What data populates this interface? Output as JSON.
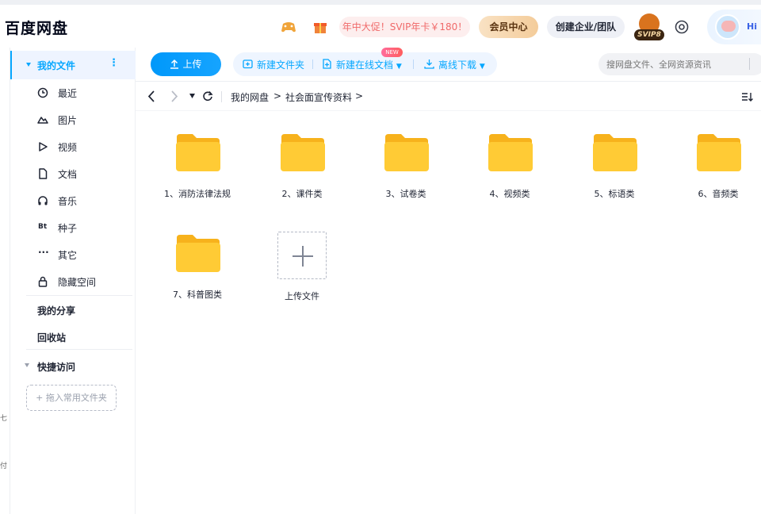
{
  "header": {
    "logo": "百度网盘",
    "promo": "年中大促！SVIP年卡￥180！",
    "vip_center": "会员中心",
    "create_team": "创建企业/团队",
    "svip_badge": "SVIP8",
    "greeting": "Hi"
  },
  "left_edge": {
    "glyphs": [
      "七",
      "付"
    ]
  },
  "sidebar": {
    "my_files": "我的文件",
    "more": "⋮",
    "items": [
      {
        "label": "最近",
        "icon": "clock-icon"
      },
      {
        "label": "图片",
        "icon": "image-icon"
      },
      {
        "label": "视频",
        "icon": "play-icon"
      },
      {
        "label": "文档",
        "icon": "document-icon"
      },
      {
        "label": "音乐",
        "icon": "headphones-icon"
      },
      {
        "label": "种子",
        "icon_text": "Bt"
      },
      {
        "label": "其它",
        "icon_text": "···"
      },
      {
        "label": "隐藏空间",
        "icon": "lock-icon"
      }
    ],
    "my_share": "我的分享",
    "recycle_bin": "回收站",
    "quick_access": "快捷访问",
    "dropzone": "+ 拖入常用文件夹"
  },
  "toolbar": {
    "upload": "上传",
    "new_folder": "新建文件夹",
    "new_online_doc": "新建在线文档",
    "new_badge": "NEW",
    "offline_download": "离线下载",
    "search_placeholder": "搜网盘文件、全网资源资讯"
  },
  "breadcrumb": {
    "items": [
      "我的网盘",
      ">",
      "社会面宣传资料",
      ">"
    ]
  },
  "files": [
    {
      "name": "1、消防法律法规"
    },
    {
      "name": "2、课件类"
    },
    {
      "name": "3、试卷类"
    },
    {
      "name": "4、视频类"
    },
    {
      "name": "5、标语类"
    },
    {
      "name": "6、音频类"
    },
    {
      "name": "7、科普图类"
    }
  ],
  "upload_tile": {
    "label": "上传文件"
  },
  "colors": {
    "accent": "#06a7ff",
    "folder": "#ffc933",
    "promo_text": "#f06a6a"
  }
}
